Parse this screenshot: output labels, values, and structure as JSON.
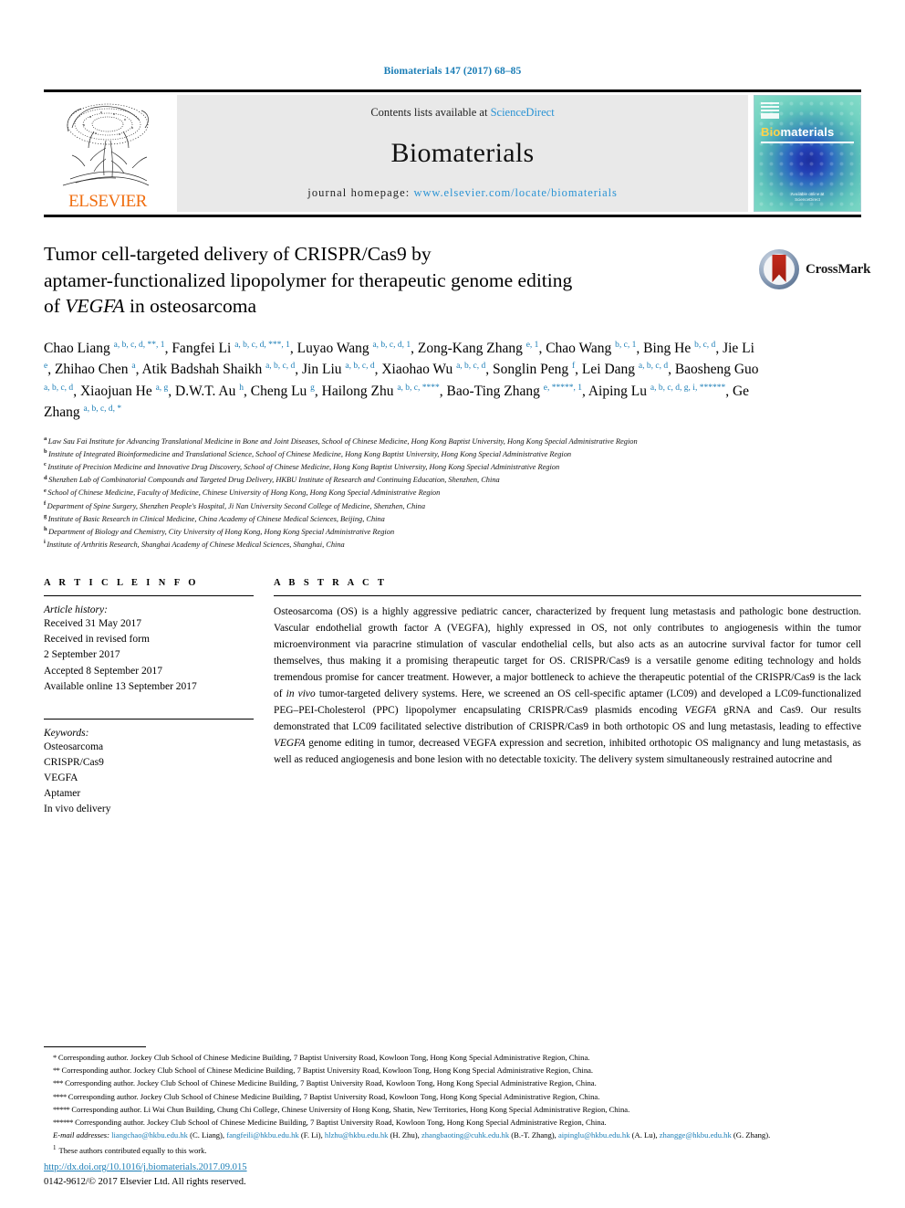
{
  "running_head": "Biomaterials 147 (2017) 68–85",
  "masthead": {
    "publisher_name": "ELSEVIER",
    "contents_prefix": "Contents lists available at ",
    "contents_link": "ScienceDirect",
    "journal_name": "Biomaterials",
    "homepage_label": "journal homepage: ",
    "homepage_url": "www.elsevier.com/locate/biomaterials",
    "cover": {
      "title_bio": "Bio",
      "title_rest": "materials",
      "footer_line1": "Available online at",
      "footer_line2": "ScienceDirect"
    }
  },
  "title": {
    "line1": "Tumor cell-targeted delivery of CRISPR/Cas9 by",
    "line2": "aptamer-functionalized lipopolymer for therapeutic genome editing",
    "line3_pre": "of ",
    "line3_em": "VEGFA",
    "line3_post": " in osteosarcoma"
  },
  "crossmark": {
    "label": "CrossMark"
  },
  "authors_html": "Chao Liang <sup>a, b, c, d, **, 1</sup>, Fangfei Li <sup>a, b, c, d, ***, 1</sup>, Luyao Wang <sup>a, b, c, d, 1</sup>, Zong-Kang Zhang <sup>e, 1</sup>, Chao Wang <sup>b, c, 1</sup>, Bing He <sup>b, c, d</sup>, Jie Li <sup>e</sup>, Zhihao Chen <sup>a</sup>, Atik Badshah Shaikh <sup>a, b, c, d</sup>, Jin Liu <sup>a, b, c, d</sup>, Xiaohao Wu <sup>a, b, c, d</sup>, Songlin Peng <sup>f</sup>, Lei Dang <sup>a, b, c, d</sup>, Baosheng Guo <sup>a, b, c, d</sup>, Xiaojuan He <sup>a, g</sup>, D.W.T. Au <sup>h</sup>, Cheng Lu <sup>g</sup>, Hailong Zhu <sup>a, b, c, ****</sup>, Bao-Ting Zhang <sup>e, *****, 1</sup>, Aiping Lu <sup>a, b, c, d, g, i, ******</sup>, Ge Zhang <sup>a, b, c, d, *</sup>",
  "affiliations": [
    {
      "marker": "a",
      "text": "Law Sau Fai Institute for Advancing Translational Medicine in Bone and Joint Diseases, School of Chinese Medicine, Hong Kong Baptist University, Hong Kong Special Administrative Region"
    },
    {
      "marker": "b",
      "text": "Institute of Integrated Bioinformedicine and Translational Science, School of Chinese Medicine, Hong Kong Baptist University, Hong Kong Special Administrative Region"
    },
    {
      "marker": "c",
      "text": "Institute of Precision Medicine and Innovative Drug Discovery, School of Chinese Medicine, Hong Kong Baptist University, Hong Kong Special Administrative Region"
    },
    {
      "marker": "d",
      "text": "Shenzhen Lab of Combinatorial Compounds and Targeted Drug Delivery, HKBU Institute of Research and Continuing Education, Shenzhen, China"
    },
    {
      "marker": "e",
      "text": "School of Chinese Medicine, Faculty of Medicine, Chinese University of Hong Kong, Hong Kong Special Administrative Region"
    },
    {
      "marker": "f",
      "text": "Department of Spine Surgery, Shenzhen People's Hospital, Ji Nan University Second College of Medicine, Shenzhen, China"
    },
    {
      "marker": "g",
      "text": "Institute of Basic Research in Clinical Medicine, China Academy of Chinese Medical Sciences, Beijing, China"
    },
    {
      "marker": "h",
      "text": "Department of Biology and Chemistry, City University of Hong Kong, Hong Kong Special Administrative Region"
    },
    {
      "marker": "i",
      "text": "Institute of Arthritis Research, Shanghai Academy of Chinese Medical Sciences, Shanghai, China"
    }
  ],
  "article_info": {
    "heading": "A R T I C L E  I N F O",
    "history_label": "Article history:",
    "history": [
      "Received 31 May 2017",
      "Received in revised form",
      "2 September 2017",
      "Accepted 8 September 2017",
      "Available online 13 September 2017"
    ],
    "keywords_label": "Keywords:",
    "keywords": [
      "Osteosarcoma",
      "CRISPR/Cas9",
      "VEGFA",
      "Aptamer",
      "In vivo delivery"
    ]
  },
  "abstract": {
    "heading": "A B S T R A C T",
    "body_html": "Osteosarcoma (OS) is a highly aggressive pediatric cancer, characterized by frequent lung metastasis and pathologic bone destruction. Vascular endothelial growth factor A (VEGFA), highly expressed in OS, not only contributes to angiogenesis within the tumor microenvironment via paracrine stimulation of vascular endothelial cells, but also acts as an autocrine survival factor for tumor cell themselves, thus making it a promising therapeutic target for OS. CRISPR/Cas9 is a versatile genome editing technology and holds tremendous promise for cancer treatment. However, a major bottleneck to achieve the therapeutic potential of the CRISPR/Cas9 is the lack of <em>in vivo</em> tumor-targeted delivery systems. Here, we screened an OS cell-specific aptamer (LC09) and developed a LC09-functionalized PEG–PEI-Cholesterol (PPC) lipopolymer encapsulating CRISPR/Cas9 plasmids encoding <em>VEGFA</em> gRNA and Cas9. Our results demonstrated that LC09 facilitated selective distribution of CRISPR/Cas9 in both orthotopic OS and lung metastasis, leading to effective <em>VEGFA</em> genome editing in tumor, decreased VEGFA expression and secretion, inhibited orthotopic OS malignancy and lung metastasis, as well as reduced angiogenesis and bone lesion with no detectable toxicity. The delivery system simultaneously restrained autocrine and"
  },
  "footnotes": [
    {
      "star": "*",
      "text": "Corresponding author. Jockey Club School of Chinese Medicine Building, 7 Baptist University Road, Kowloon Tong, Hong Kong Special Administrative Region, China."
    },
    {
      "star": "**",
      "text": "Corresponding author. Jockey Club School of Chinese Medicine Building, 7 Baptist University Road, Kowloon Tong, Hong Kong Special Administrative Region, China."
    },
    {
      "star": "***",
      "text": "Corresponding author. Jockey Club School of Chinese Medicine Building, 7 Baptist University Road, Kowloon Tong, Hong Kong Special Administrative Region, China."
    },
    {
      "star": "****",
      "text": "Corresponding author. Jockey Club School of Chinese Medicine Building, 7 Baptist University Road, Kowloon Tong, Hong Kong Special Administrative Region, China."
    },
    {
      "star": "*****",
      "text": "Corresponding author. Li Wai Chun Building, Chung Chi College, Chinese University of Hong Kong, Shatin, New Territories, Hong Kong Special Administrative Region, China."
    },
    {
      "star": "******",
      "text": "Corresponding author. Jockey Club School of Chinese Medicine Building, 7 Baptist University Road, Kowloon Tong, Hong Kong Special Administrative Region, China."
    }
  ],
  "email_note_html": "<span class=\"lbl\">E-mail addresses:</span> <span class=\"link\">liangchao@hkbu.edu.hk</span> (C. Liang), <span class=\"link\">fangfeili@hkbu.edu.hk</span> (F. Li), <span class=\"link\">hlzhu@hkbu.edu.hk</span> (H. Zhu), <span class=\"link\">zhangbaoting@cuhk.edu.hk</span> (B.-T. Zhang), <span class=\"link\">aipinglu@hkbu.edu.hk</span> (A. Lu), <span class=\"link\">zhangge@hkbu.edu.hk</span> (G. Zhang).",
  "equal_contribution": "These authors contributed equally to this work.",
  "equal_marker": "1",
  "doi": "http://dx.doi.org/10.1016/j.biomaterials.2017.09.015",
  "copyright": "0142-9612/© 2017 Elsevier Ltd. All rights reserved.",
  "colors": {
    "link_blue": "#1a7db6",
    "sciencedirect_blue": "#2a93d4",
    "elsevier_orange": "#f06e10",
    "crossmark_red": "#c32a1c"
  }
}
